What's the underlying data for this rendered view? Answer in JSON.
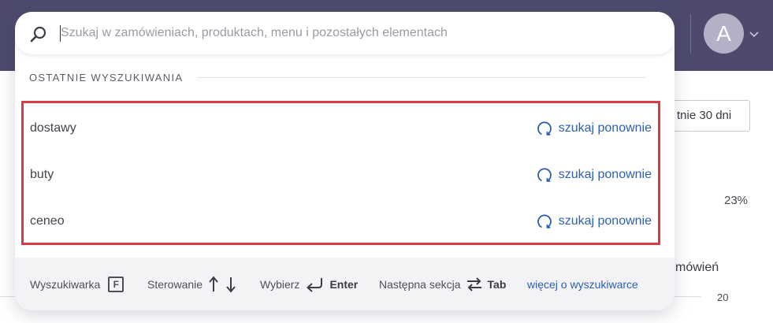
{
  "colors": {
    "topbar": "#4d4a6e",
    "highlight_border": "#d93a44",
    "link": "#2d5fae",
    "footer_bg": "#f3f3f6"
  },
  "header": {
    "avatar_initial": "A",
    "avatar_chevron_icon": "chevron-down-icon"
  },
  "background": {
    "date_range_label": "tnie 30 dni",
    "percent_value": "23%",
    "orders_label": "mówień",
    "axis_tick": "20"
  },
  "search": {
    "icon": "search-icon",
    "value": "",
    "placeholder": "Szukaj w zamówieniach, produktach, menu i pozostałych elementach"
  },
  "recent": {
    "title": "OSTATNIE WYSZUKIWANIA",
    "items": [
      {
        "term": "dostawy",
        "action_label": "szukaj ponownie",
        "action_icon": "refresh-icon"
      },
      {
        "term": "buty",
        "action_label": "szukaj ponownie",
        "action_icon": "refresh-icon"
      },
      {
        "term": "ceneo",
        "action_label": "szukaj ponownie",
        "action_icon": "refresh-icon"
      }
    ]
  },
  "footer": {
    "search_engine_label": "Wyszukiwarka",
    "search_engine_key": "F",
    "navigation_label": "Sterowanie",
    "select_label": "Wybierz",
    "select_key": "Enter",
    "next_section_label": "Następna sekcja",
    "next_section_key": "Tab",
    "more_link": "więcej o wyszukiwarce"
  }
}
